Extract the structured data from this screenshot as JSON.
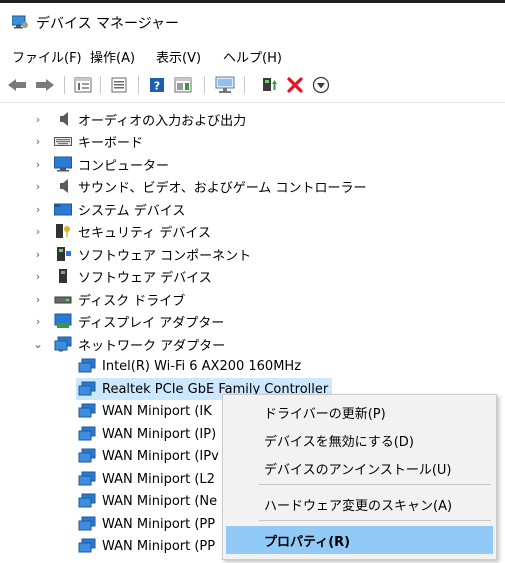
{
  "window": {
    "title": "デバイス マネージャー"
  },
  "menu": [
    "ファイル(F)",
    "操作(A)",
    "表示(V)",
    "ヘルプ(H)"
  ],
  "toolbar": {
    "buttons": [
      "back-icon",
      "forward-icon",
      "properties-view-icon",
      "list-icon",
      "help-icon",
      "details-icon",
      "monitor-scan-icon",
      "update-driver-icon",
      "uninstall-icon",
      "download-icon"
    ]
  },
  "tree": {
    "categories": [
      "オーディオの入力および出力",
      "キーボード",
      "コンピューター",
      "サウンド、ビデオ、およびゲーム コントローラー",
      "システム デバイス",
      "セキュリティ デバイス",
      "ソフトウェア コンポーネント",
      "ソフトウェア デバイス",
      "ディスク ドライブ",
      "ディスプレイ アダプター",
      "ネットワーク アダプター"
    ],
    "network_children": [
      "Intel(R) Wi-Fi 6 AX200 160MHz",
      "Realtek PCIe GbE Family Controller",
      "WAN Miniport (IK",
      "WAN Miniport (IP)",
      "WAN Miniport (IPv",
      "WAN Miniport (L2",
      "WAN Miniport (Ne",
      "WAN Miniport (PP",
      "WAN Miniport (PP"
    ],
    "selected": "Realtek PCIe GbE Family Controller"
  },
  "context_menu": {
    "items": [
      "ドライバーの更新(P)",
      "デバイスを無効にする(D)",
      "デバイスのアンインストール(U)",
      "ハードウェア変更のスキャン(A)",
      "プロパティ(R)"
    ],
    "highlighted": "プロパティ(R)"
  },
  "colors": {
    "selection": "#cce8ff",
    "menu_highlight": "#91c9f7",
    "menu_bg": "#f2f2f2",
    "uninstall_red": "#e81123",
    "help_blue": "#1a5fb4"
  }
}
